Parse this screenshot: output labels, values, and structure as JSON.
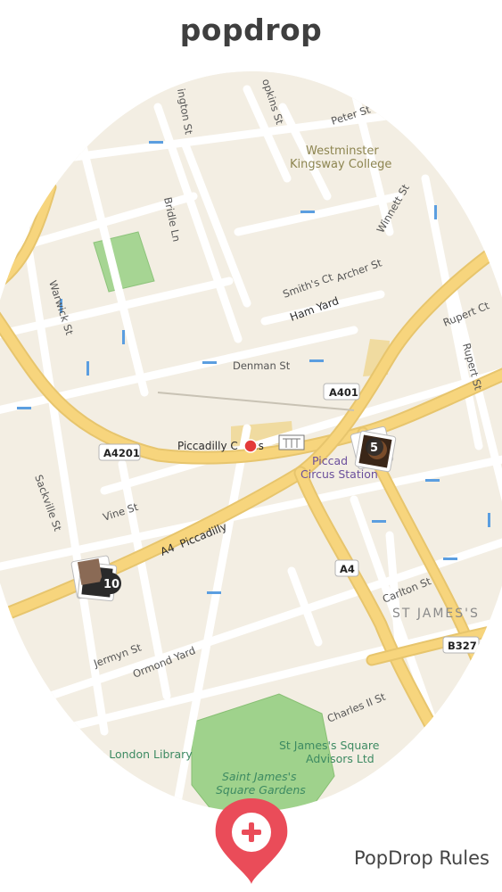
{
  "app": {
    "logo": "popdrop"
  },
  "footer": {
    "rules_label": "PopDrop Rules"
  },
  "colors": {
    "accent": "#ea4c59",
    "map_bg": "#f3eee3",
    "major_road": "#f7d57d",
    "park": "#9fd28c"
  },
  "map": {
    "streets": [
      "Warwick St",
      "Bridle Ln",
      "Denman St",
      "Sackville St",
      "Vine St",
      "Jermyn St",
      "Ormond Yard",
      "Charles II St",
      "Carlton St",
      "Rupert Ct",
      "Rupert St",
      "Archer St",
      "Smith's Ct",
      "Winnett St",
      "Peter St",
      "ington St",
      "opkins St"
    ],
    "pois": {
      "college": [
        "Westminster",
        "Kingsway College"
      ],
      "library": "The London Library",
      "square": [
        "Saint James's",
        "Square Gardens"
      ],
      "advisors": [
        "St James's Square",
        "Advisors Ltd"
      ],
      "station": [
        "Piccad",
        "Circus Station"
      ],
      "circus": "Piccadilly C    us",
      "ham_yard": "Ham Yard",
      "piccadilly": "A4  Piccadilly",
      "st_james": "ST JAMES'S"
    },
    "road_shields": [
      "A401",
      "A4201",
      "A4",
      "B327"
    ],
    "clusters": [
      {
        "count": "5"
      },
      {
        "count": "10"
      }
    ]
  },
  "icons": {
    "add": "plus-icon",
    "pin": "map-pin-icon"
  }
}
